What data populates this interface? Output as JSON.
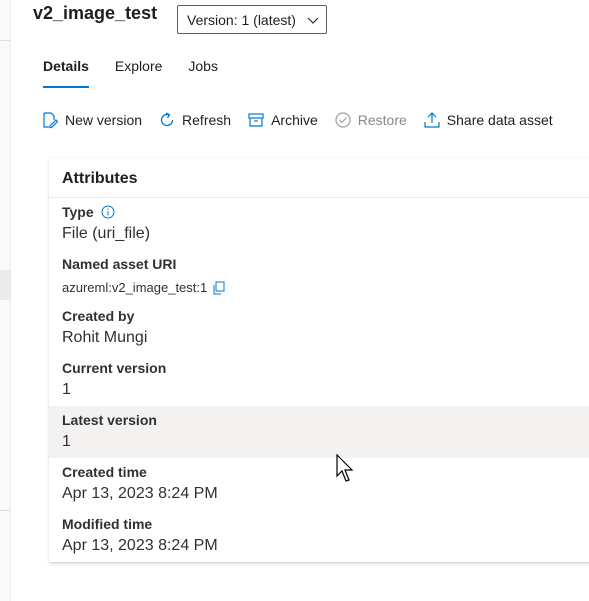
{
  "asset": {
    "title": "v2_image_test",
    "version_label": "Version: 1 (latest)"
  },
  "tabs": [
    {
      "label": "Details"
    },
    {
      "label": "Explore"
    },
    {
      "label": "Jobs"
    }
  ],
  "toolbar": {
    "new_version": "New version",
    "refresh": "Refresh",
    "archive": "Archive",
    "restore": "Restore",
    "share": "Share data asset"
  },
  "attributes": {
    "heading": "Attributes",
    "rows": [
      {
        "label": "Type",
        "value": "File (uri_file)"
      },
      {
        "label": "Named asset URI",
        "value": "azureml:v2_image_test:1"
      },
      {
        "label": "Created by",
        "value": "Rohit Mungi"
      },
      {
        "label": "Current version",
        "value": "1"
      },
      {
        "label": "Latest version",
        "value": "1"
      },
      {
        "label": "Created time",
        "value": "Apr 13, 2023 8:24 PM"
      },
      {
        "label": "Modified time",
        "value": "Apr 13, 2023 8:24 PM"
      }
    ]
  },
  "colors": {
    "accent": "#0078d4",
    "text": "#201f1e",
    "disabled": "#8a8886",
    "row_highlight": "#f3f2f1"
  }
}
